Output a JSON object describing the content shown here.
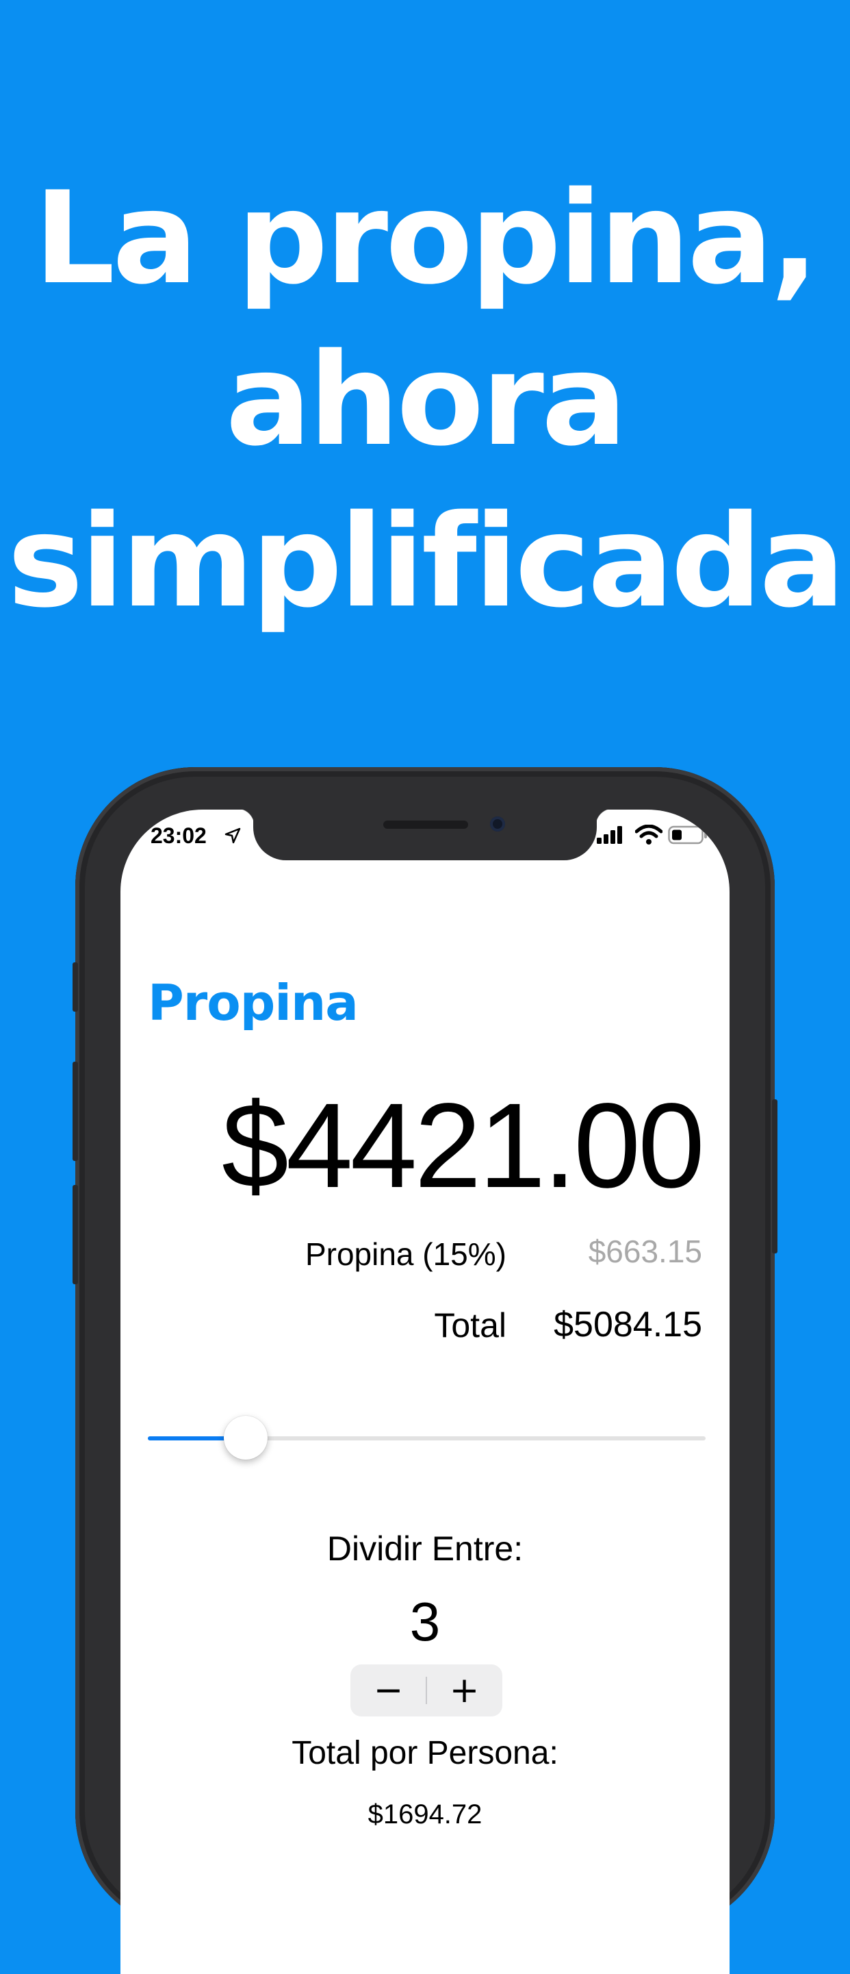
{
  "headline": [
    "La propina,",
    "ahora",
    "simplificada"
  ],
  "status_bar": {
    "time": "23:02"
  },
  "app": {
    "title": "Propina",
    "amount": "$4421.00",
    "tip_label": "Propina  (15%)",
    "tip_value": "$663.15",
    "total_label": "Total",
    "total_value": "$5084.15",
    "tip_slider": {
      "fraction": 0.176
    },
    "split_label": "Dividir Entre:",
    "split_count": "3",
    "stepper_minus": "−",
    "stepper_plus": "+",
    "per_person_label": "Total por Persona:",
    "per_person_value": "$1694.72"
  },
  "colors": {
    "background": "#0a8ff2",
    "accent": "#0a8ff2",
    "slider_fill": "#0a7cf2"
  }
}
